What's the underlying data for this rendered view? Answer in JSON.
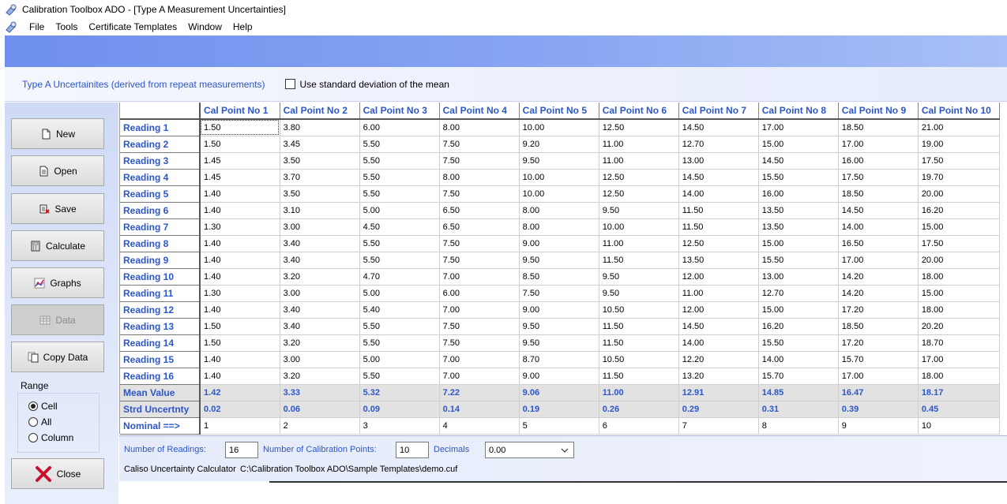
{
  "window": {
    "title": "Calibration Toolbox ADO - [Type A Measurement Uncertainties]"
  },
  "menu": [
    "File",
    "Tools",
    "Certificate Templates",
    "Window",
    "Help"
  ],
  "options": {
    "heading": "Type A Uncertainites (derived from repeat measurements)",
    "std_dev_label": "Use standard deviation of the mean",
    "std_dev_checked": false
  },
  "buttons": {
    "new": "New",
    "open": "Open",
    "save": "Save",
    "calculate": "Calculate",
    "graphs": "Graphs",
    "data": "Data",
    "copy_data": "Copy Data",
    "close": "Close"
  },
  "range": {
    "title": "Range",
    "options": [
      "Cell",
      "All",
      "Column"
    ],
    "selected": "Cell"
  },
  "grid": {
    "columns": [
      "Cal Point No 1",
      "Cal Point No 2",
      "Cal Point No 3",
      "Cal Point No 4",
      "Cal Point No 5",
      "Cal Point No 6",
      "Cal Point No 7",
      "Cal Point No 8",
      "Cal Point No 9",
      "Cal Point No 10"
    ],
    "readings": [
      {
        "label": "Reading 1",
        "values": [
          "1.50",
          "3.80",
          "6.00",
          "8.00",
          "10.00",
          "12.50",
          "14.50",
          "17.00",
          "18.50",
          "21.00"
        ]
      },
      {
        "label": "Reading 2",
        "values": [
          "1.50",
          "3.45",
          "5.50",
          "7.50",
          "9.20",
          "11.00",
          "12.70",
          "15.00",
          "17.00",
          "19.00"
        ]
      },
      {
        "label": "Reading 3",
        "values": [
          "1.45",
          "3.50",
          "5.50",
          "7.50",
          "9.50",
          "11.00",
          "13.00",
          "14.50",
          "16.00",
          "17.50"
        ]
      },
      {
        "label": "Reading 4",
        "values": [
          "1.45",
          "3.70",
          "5.50",
          "8.00",
          "10.00",
          "12.50",
          "14.50",
          "15.50",
          "17.50",
          "19.70"
        ]
      },
      {
        "label": "Reading 5",
        "values": [
          "1.40",
          "3.50",
          "5.50",
          "7.50",
          "10.00",
          "12.50",
          "14.00",
          "16.00",
          "18.50",
          "20.00"
        ]
      },
      {
        "label": "Reading 6",
        "values": [
          "1.40",
          "3.10",
          "5.00",
          "6.50",
          "8.00",
          "9.50",
          "11.50",
          "13.50",
          "14.50",
          "16.20"
        ]
      },
      {
        "label": "Reading 7",
        "values": [
          "1.30",
          "3.00",
          "4.50",
          "6.50",
          "8.00",
          "10.00",
          "11.50",
          "13.50",
          "14.00",
          "15.00"
        ]
      },
      {
        "label": "Reading 8",
        "values": [
          "1.40",
          "3.40",
          "5.50",
          "7.50",
          "9.00",
          "11.00",
          "12.50",
          "15.00",
          "16.50",
          "17.50"
        ]
      },
      {
        "label": "Reading 9",
        "values": [
          "1.40",
          "3.40",
          "5.50",
          "7.50",
          "9.50",
          "11.50",
          "13.50",
          "15.50",
          "17.00",
          "20.00"
        ]
      },
      {
        "label": "Reading 10",
        "values": [
          "1.40",
          "3.20",
          "4.70",
          "7.00",
          "8.50",
          "9.50",
          "12.00",
          "13.00",
          "14.20",
          "18.00"
        ]
      },
      {
        "label": "Reading 11",
        "values": [
          "1.30",
          "3.00",
          "5.00",
          "6.00",
          "7.50",
          "9.50",
          "11.00",
          "12.70",
          "14.20",
          "15.00"
        ]
      },
      {
        "label": "Reading 12",
        "values": [
          "1.40",
          "3.40",
          "5.40",
          "7.00",
          "9.00",
          "10.50",
          "12.00",
          "15.00",
          "17.20",
          "18.00"
        ]
      },
      {
        "label": "Reading 13",
        "values": [
          "1.50",
          "3.40",
          "5.50",
          "7.50",
          "9.50",
          "11.50",
          "14.50",
          "16.20",
          "18.50",
          "20.20"
        ]
      },
      {
        "label": "Reading 14",
        "values": [
          "1.50",
          "3.20",
          "5.50",
          "7.50",
          "9.50",
          "11.50",
          "14.00",
          "15.50",
          "17.20",
          "18.70"
        ]
      },
      {
        "label": "Reading 15",
        "values": [
          "1.40",
          "3.00",
          "5.00",
          "7.00",
          "8.70",
          "10.50",
          "12.20",
          "14.00",
          "15.70",
          "17.00"
        ]
      },
      {
        "label": "Reading 16",
        "values": [
          "1.40",
          "3.20",
          "5.50",
          "7.00",
          "9.00",
          "11.50",
          "13.20",
          "15.70",
          "17.00",
          "18.00"
        ]
      }
    ],
    "mean": {
      "label": "Mean Value",
      "values": [
        "1.42",
        "3.33",
        "5.32",
        "7.22",
        "9.06",
        "11.00",
        "12.91",
        "14.85",
        "16.47",
        "18.17"
      ]
    },
    "uncertainty": {
      "label": "Strd Uncertnty",
      "values": [
        "0.02",
        "0.06",
        "0.09",
        "0.14",
        "0.19",
        "0.26",
        "0.29",
        "0.31",
        "0.39",
        "0.45"
      ]
    },
    "nominal": {
      "label": "Nominal    ==>",
      "values": [
        "1",
        "2",
        "3",
        "4",
        "5",
        "6",
        "7",
        "8",
        "9",
        "10"
      ]
    }
  },
  "bottom": {
    "num_readings_label": "Number of Readings:",
    "num_readings": "16",
    "num_points_label": "Number of Calibration Points:",
    "num_points": "10",
    "decimals_label": "Decimals",
    "decimals": "0.00",
    "status_app": "Caliso Uncertainty Calculator",
    "status_path": "C:\\Calibration Toolbox ADO\\Sample Templates\\demo.cuf"
  },
  "colors": {
    "accent_blue": "#2d56c8",
    "banner_start": "#6f8fee",
    "banner_end": "#a9c0f6"
  }
}
